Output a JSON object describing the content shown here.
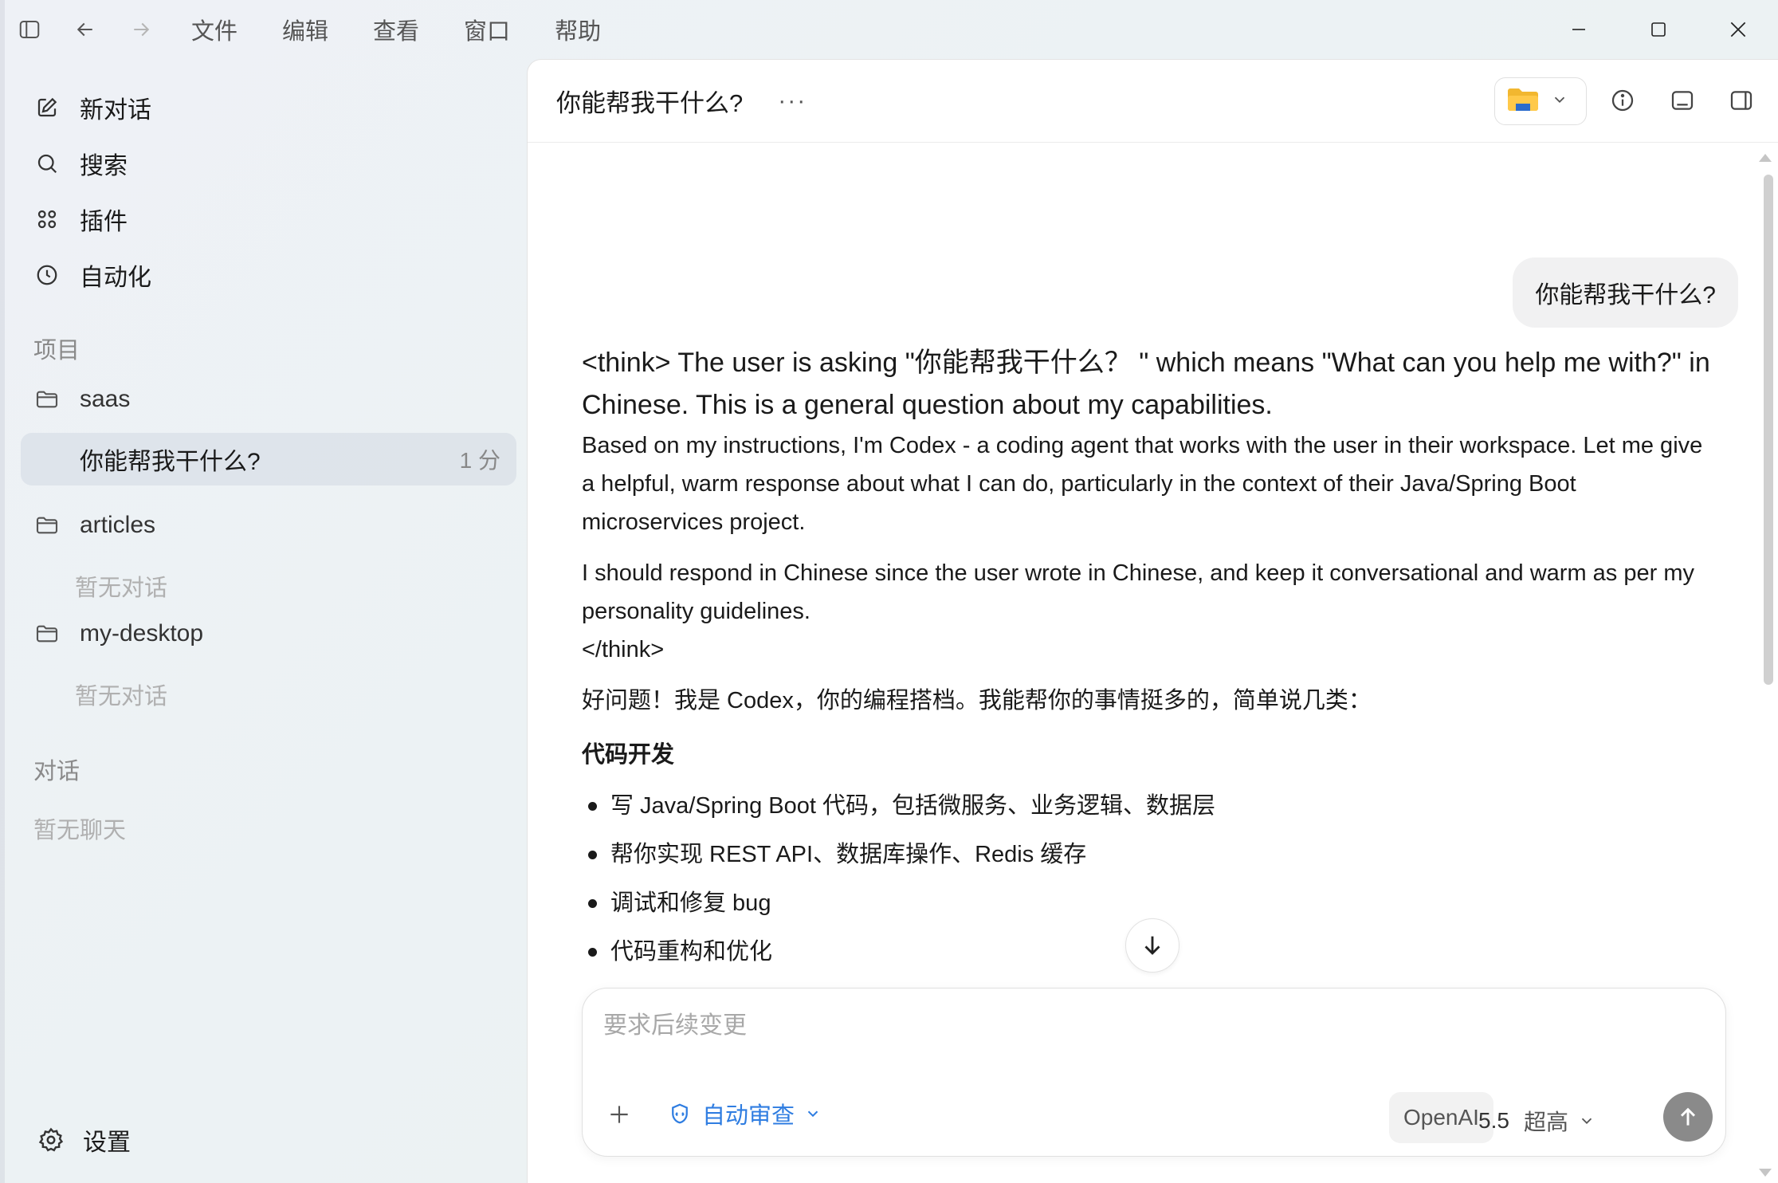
{
  "menu": {
    "file": "文件",
    "edit": "编辑",
    "view": "查看",
    "window": "窗口",
    "help": "帮助"
  },
  "sidebar": {
    "new_chat": "新对话",
    "search": "搜索",
    "plugins": "插件",
    "automation": "自动化",
    "projects_label": "项目",
    "projects": [
      {
        "name": "saas"
      },
      {
        "name": "articles",
        "empty": "暂无对话"
      },
      {
        "name": "my-desktop",
        "empty": "暂无对话"
      }
    ],
    "active_conversation": {
      "title": "你能帮我干什么?",
      "time": "1 分"
    },
    "chats_label": "对话",
    "chats_empty": "暂无聊天",
    "settings": "设置"
  },
  "header": {
    "title": "你能帮我干什么?",
    "more": "···"
  },
  "conversation": {
    "user_message": "你能帮我干什么?",
    "think_intro": "<think> The user is asking \"你能帮我干什么？ \" which means \"What can you help me with?\" in Chinese. This is a general question about my capabilities.",
    "think_p1": "Based on my instructions, I'm Codex - a coding agent that works with the user in their workspace. Let me give a helpful, warm response about what I can do, particularly in the context of their Java/Spring Boot microservices project.",
    "think_p2": "I should respond in Chinese since the user wrote in Chinese, and keep it conversational and warm as per my personality guidelines.",
    "think_close": "</think>",
    "reply_intro": "好问题！我是 Codex，你的编程搭档。我能帮你的事情挺多的，简单说几类：",
    "section_title": "代码开发",
    "bullets": [
      "写 Java/Spring Boot 代码，包括微服务、业务逻辑、数据层",
      "帮你实现 REST API、数据库操作、Redis 缓存",
      "调试和修复 bug",
      "代码重构和优化"
    ]
  },
  "composer": {
    "placeholder": "要求后续变更",
    "review_mode": "自动审查",
    "provider": "OpenAI",
    "model": "5.5",
    "level": "超高"
  },
  "colors": {
    "accent_blue": "#2f7de1",
    "send_button": "#8a8a8a",
    "active_row": "#d2d8e1"
  }
}
